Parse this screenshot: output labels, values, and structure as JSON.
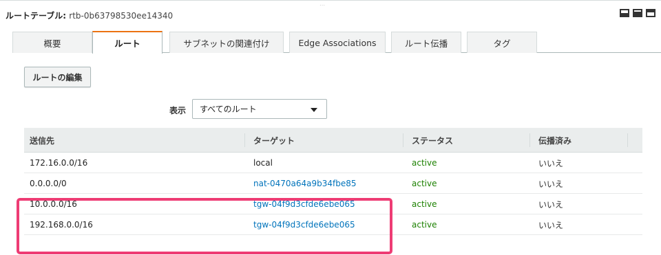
{
  "header": {
    "label": "ルートテーブル: ",
    "table_id": "rtb-0b63798530ee14340"
  },
  "tabs": [
    {
      "label": "概要"
    },
    {
      "label": "ルート"
    },
    {
      "label": "サブネットの関連付け"
    },
    {
      "label": "Edge Associations"
    },
    {
      "label": "ルート伝播"
    },
    {
      "label": "タグ"
    }
  ],
  "active_tab": "ルート",
  "toolbar": {
    "edit_label": "ルートの編集"
  },
  "filter": {
    "label": "表示",
    "selected": "すべてのルート"
  },
  "routes_table": {
    "columns": [
      "送信先",
      "ターゲット",
      "ステータス",
      "伝播済み"
    ],
    "rows": [
      {
        "destination": "172.16.0.0/16",
        "target": "local",
        "status": "active",
        "propagated": "いいえ"
      },
      {
        "destination": "0.0.0.0/0",
        "target": "nat-0470a64a9b34fbe85",
        "status": "active",
        "propagated": "いいえ"
      },
      {
        "destination": "10.0.0.0/16",
        "target": "tgw-04f9d3cfde6ebe065",
        "status": "active",
        "propagated": "いいえ"
      },
      {
        "destination": "192.168.0.0/16",
        "target": "tgw-04f9d3cfde6ebe065",
        "status": "active",
        "propagated": "いいえ"
      }
    ]
  },
  "colors": {
    "accent_tab": "#ec7211",
    "link": "#0073bb",
    "status_active": "#1d8102",
    "highlight": "#ee3c74"
  },
  "icons": [
    "layout-bottom-icon",
    "layout-split-icon",
    "layout-top-icon"
  ]
}
